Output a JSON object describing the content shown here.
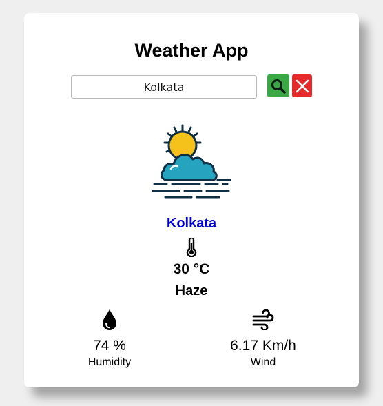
{
  "app": {
    "title": "Weather App"
  },
  "search": {
    "value": "Kolkata",
    "search_icon": "search-icon",
    "clear_icon": "close-icon"
  },
  "weather": {
    "icon": "sun-behind-cloud-haze-icon",
    "city": "Kolkata",
    "temperature": "30 °C",
    "condition": "Haze"
  },
  "stats": {
    "humidity": {
      "icon": "water-drop-icon",
      "value": "74 %",
      "label": "Humidity"
    },
    "wind": {
      "icon": "wind-icon",
      "value": "6.17 Km/h",
      "label": "Wind"
    }
  },
  "colors": {
    "page_background": "#efefef",
    "card_background": "#ffffff",
    "search_button": "#3aa845",
    "clear_button": "#e42a2a",
    "city_text": "#0000dd",
    "sun": "#f5c21b",
    "cloud": "#25a3bf",
    "outline": "#0e2f44"
  }
}
